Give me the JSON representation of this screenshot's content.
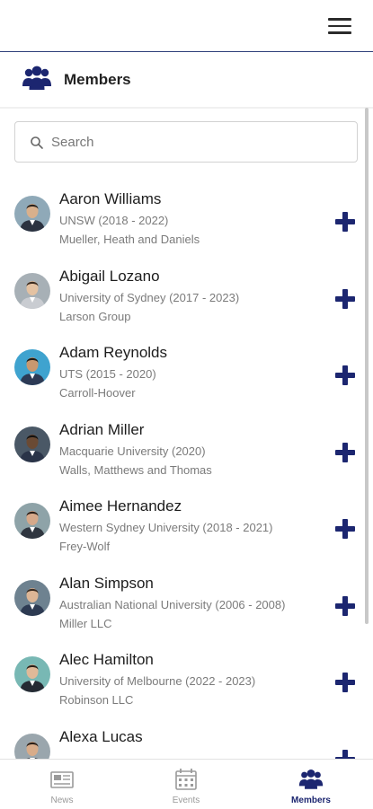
{
  "header": {
    "title": "Members"
  },
  "search": {
    "placeholder": "Search"
  },
  "members": [
    {
      "name": "Aaron Williams",
      "school": "UNSW (2018 - 2022)",
      "company": "Mueller, Heath and Daniels"
    },
    {
      "name": "Abigail Lozano",
      "school": "University of Sydney (2017 - 2023)",
      "company": "Larson Group"
    },
    {
      "name": "Adam Reynolds",
      "school": "UTS (2015 - 2020)",
      "company": "Carroll-Hoover"
    },
    {
      "name": "Adrian Miller",
      "school": "Macquarie University (2020)",
      "company": "Walls, Matthews and Thomas"
    },
    {
      "name": "Aimee Hernandez",
      "school": "Western Sydney University (2018 - 2021)",
      "company": "Frey-Wolf"
    },
    {
      "name": "Alan Simpson",
      "school": "Australian National University (2006 - 2008)",
      "company": "Miller LLC"
    },
    {
      "name": "Alec Hamilton",
      "school": "University of Melbourne (2022 - 2023)",
      "company": "Robinson LLC"
    },
    {
      "name": "Alexa Lucas",
      "school": "",
      "company": ""
    }
  ],
  "nav": [
    {
      "label": "News",
      "icon": "newspaper-icon",
      "active": false
    },
    {
      "label": "Events",
      "icon": "calendar-icon",
      "active": false
    },
    {
      "label": "Members",
      "icon": "members-icon",
      "active": true
    }
  ],
  "colors": {
    "accent": "#1c2670",
    "header_border": "#2e3f7a",
    "muted_text": "#7b7b7b"
  }
}
